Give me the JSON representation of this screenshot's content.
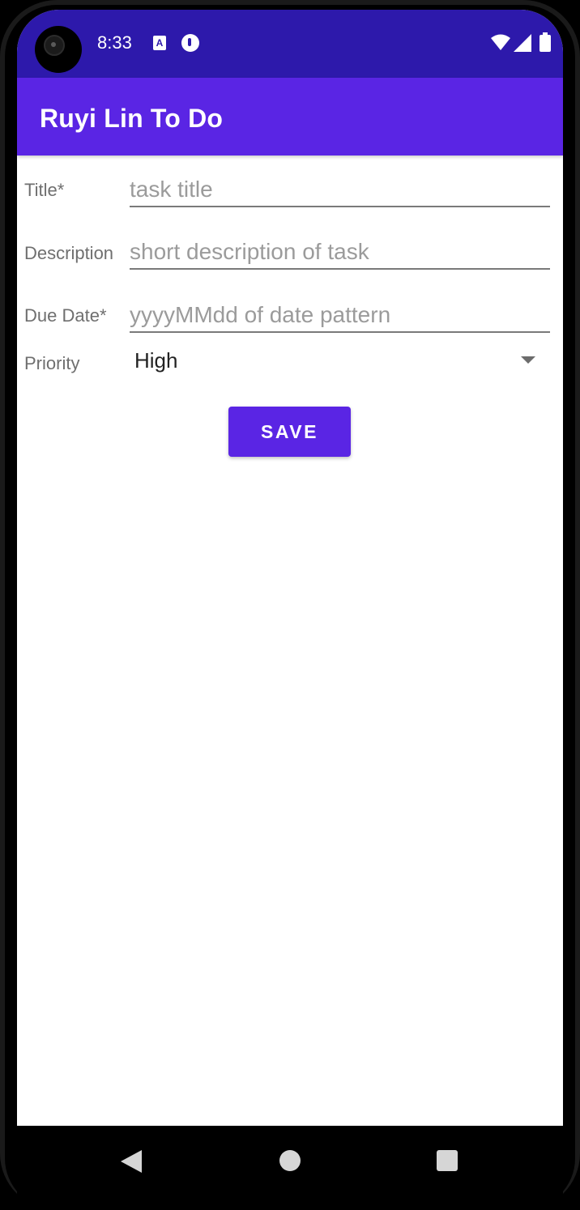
{
  "status_bar": {
    "time": "8:33",
    "notification_icons": [
      "text-a-icon",
      "circle-info-icon"
    ],
    "right_icons": [
      "wifi-icon",
      "cell-signal-icon",
      "battery-icon"
    ],
    "background_color": "#2d19ab"
  },
  "app_bar": {
    "title": "Ruyi Lin To Do",
    "background_color": "#5a25e4"
  },
  "form": {
    "title_label": "Title*",
    "title_placeholder": "task title",
    "title_value": "",
    "description_label": "Description",
    "description_placeholder": "short description of task",
    "description_value": "",
    "due_date_label": "Due Date*",
    "due_date_placeholder": "yyyyMMdd of date pattern",
    "due_date_value": "",
    "priority_label": "Priority",
    "priority_selected": "High",
    "save_label": "SAVE",
    "accent_color": "#5a25e4"
  },
  "nav_bar": {
    "buttons": [
      "back-icon",
      "home-icon",
      "recents-icon"
    ]
  }
}
